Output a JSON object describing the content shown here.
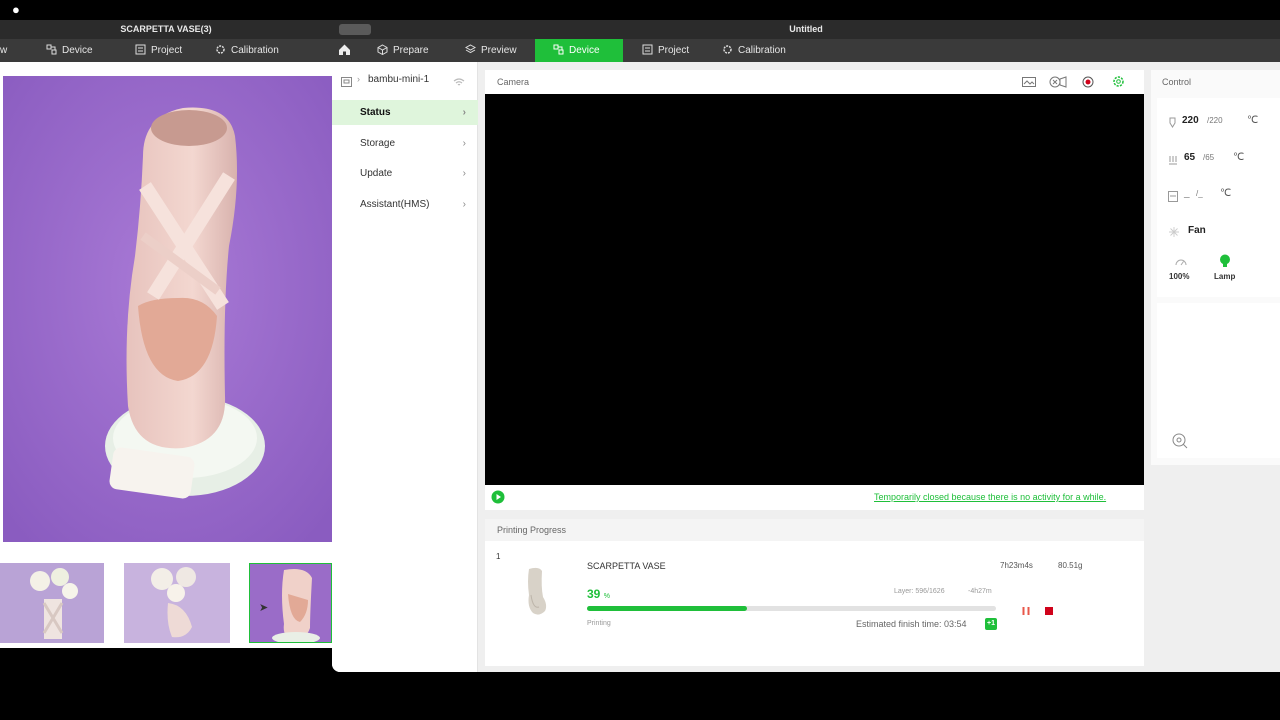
{
  "left_window": {
    "title": "SCARPETTA VASE(3)",
    "tabs": [
      "w",
      "Device",
      "Project",
      "Calibration"
    ]
  },
  "right_window": {
    "title": "Untitled",
    "tabs": [
      "Prepare",
      "Preview",
      "Device",
      "Project",
      "Calibration"
    ]
  },
  "sidebar": {
    "device_name": "bambu-mini-1",
    "items": [
      "Status",
      "Storage",
      "Update",
      "Assistant(HMS)"
    ]
  },
  "camera": {
    "label": "Camera",
    "notice": "Temporarily closed because there is no activity for a while."
  },
  "progress": {
    "label": "Printing Progress",
    "plate": "1",
    "job_name": "SCARPETTA VASE",
    "time": "7h23m4s",
    "weight": "80.51g",
    "percent": "39",
    "percent_unit": "%",
    "percent_value": 39,
    "layer": "Layer: 596/1626",
    "remaining": "-4h27m",
    "state": "Printing",
    "finish": "Estimated finish time: 03:54",
    "day_badge": "+1"
  },
  "control": {
    "label": "Control",
    "nozzle_temp": "220",
    "nozzle_target": "/220",
    "bed_temp": "65",
    "bed_target": "/65",
    "chamber_temp": "_",
    "chamber_target": "/_",
    "unit": "℃",
    "fan": "Fan",
    "speed": "100%",
    "lamp": "Lamp"
  },
  "colors": {
    "accent": "#1fbf3a",
    "stop": "#d0021b",
    "pause": "#e8574a",
    "hero_bg": "#9a6cc8"
  }
}
